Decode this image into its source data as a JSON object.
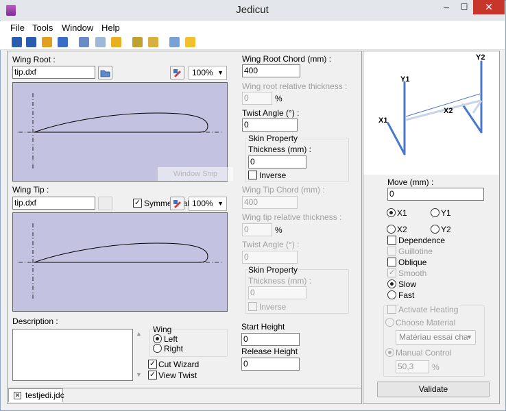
{
  "window": {
    "title": "Jedicut",
    "min_glyph": "–",
    "max_glyph": "☐",
    "close_glyph": "✕"
  },
  "menu": [
    "File",
    "Tools",
    "Window",
    "Help"
  ],
  "toolbar": {
    "icons": [
      "open-dxf-icon",
      "open-project-icon",
      "folder-open-icon",
      "save-icon",
      "cut-icon",
      "wizard-icon",
      "plugin-icon",
      "wing-icon",
      "machine-icon",
      "settings-icon",
      "help-icon"
    ],
    "colors": [
      "#2a5db0",
      "#2a5db0",
      "#e0a020",
      "#3a6cc8",
      "#6a8ac8",
      "#a0b8d8",
      "#e8b020",
      "#c0a030",
      "#d8b040",
      "#7aa0d8",
      "#f0c030"
    ]
  },
  "wing_root": {
    "label": "Wing Root :",
    "file": "tip.dxf",
    "zoom": "100%"
  },
  "wing_tip": {
    "label": "Wing Tip :",
    "file": "tip.dxf",
    "zoom": "100%",
    "symmetrical_label": "Symmetrical p",
    "symmetrical_checked": true
  },
  "watermark": "Window Snip",
  "root_params": {
    "chord_label": "Wing Root Chord (mm) :",
    "chord_value": "400",
    "thickness_label": "Wing root relative thickness :",
    "thickness_value": "0",
    "pct": "%",
    "twist_label": "Twist Angle (°) :",
    "twist_value": "0",
    "skin_label": "Skin Property",
    "skin_thickness_label": "Thickness (mm) :",
    "skin_thickness_value": "0",
    "inverse_label": "Inverse"
  },
  "tip_params": {
    "chord_label": "Wing Tip Chord (mm) :",
    "chord_value": "400",
    "thickness_label": "Wing tip relative thickness :",
    "thickness_value": "0",
    "pct": "%",
    "twist_label": "Twist Angle (°) :",
    "twist_value": "0",
    "skin_label": "Skin Property",
    "skin_thickness_label": "Thickness (mm) :",
    "skin_thickness_value": "0",
    "inverse_label": "Inverse"
  },
  "description_label": "Description :",
  "wing_group": {
    "label": "Wing",
    "left": "Left",
    "right": "Right",
    "selected": "Left"
  },
  "cut_wizard": {
    "label": "Cut Wizard",
    "checked": true
  },
  "view_twist": {
    "label": "View Twist",
    "checked": true
  },
  "start_height": {
    "label": "Start Height",
    "value": "0"
  },
  "release_height": {
    "label": "Release Height",
    "value": "0"
  },
  "tab": {
    "label": "testjedi.jdc",
    "close": "✕"
  },
  "axes_diagram": {
    "y1": "Y1",
    "y2": "Y2",
    "x1": "X1",
    "x2": "X2"
  },
  "move": {
    "label": "Move (mm) :",
    "value": "0"
  },
  "axes": {
    "x1": "X1",
    "y1": "Y1",
    "x2": "X2",
    "y2": "Y2",
    "selected": "X1"
  },
  "options": [
    {
      "label": "Dependence",
      "checked": false,
      "disabled": false
    },
    {
      "label": "Guillotine",
      "checked": false,
      "disabled": true
    },
    {
      "label": "Oblique",
      "checked": false,
      "disabled": false
    },
    {
      "label": "Smooth",
      "checked": true,
      "disabled": true
    }
  ],
  "speed": {
    "slow": "Slow",
    "fast": "Fast",
    "selected": "Slow"
  },
  "heating": {
    "activate_label": "Activate Heating",
    "choose_material_label": "Choose Material",
    "material_value": "Matériau essai cha",
    "manual_label": "Manual Control",
    "manual_value": "50,3",
    "pct": "%"
  },
  "validate_label": "Validate",
  "splitter_glyph": "▸"
}
